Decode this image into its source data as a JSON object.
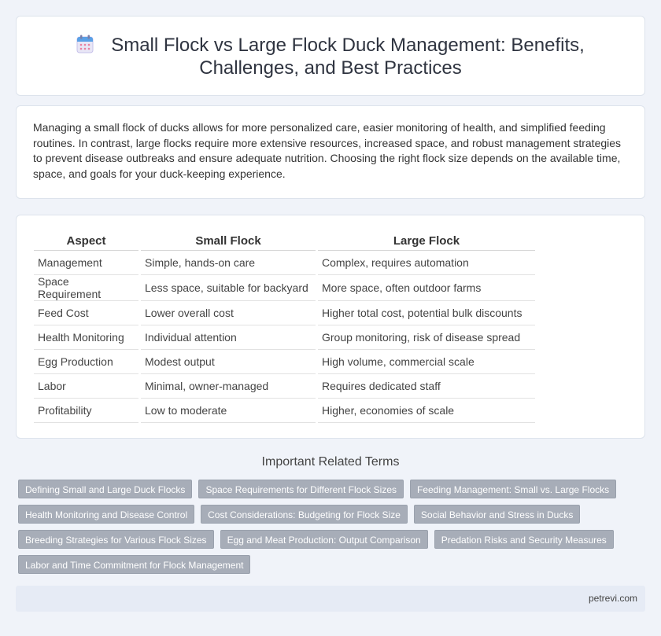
{
  "header": {
    "title_line1": "Small Flock vs Large Flock Duck Management: Benefits,",
    "title_line2": "Challenges, and Best Practices",
    "icon": "calendar-icon"
  },
  "intro": {
    "text": "Managing a small flock of ducks allows for more personalized care, easier monitoring of health, and simplified feeding routines. In contrast, large flocks require more extensive resources, increased space, and robust management strategies to prevent disease outbreaks and ensure adequate nutrition. Choosing the right flock size depends on the available time, space, and goals for your duck-keeping experience."
  },
  "comparison": {
    "headers": [
      "Aspect",
      "Small Flock",
      "Large Flock"
    ],
    "rows": [
      [
        "Management",
        "Simple, hands-on care",
        "Complex, requires automation"
      ],
      [
        "Space Requirement",
        "Less space, suitable for backyard",
        "More space, often outdoor farms"
      ],
      [
        "Feed Cost",
        "Lower overall cost",
        "Higher total cost, potential bulk discounts"
      ],
      [
        "Health Monitoring",
        "Individual attention",
        "Group monitoring, risk of disease spread"
      ],
      [
        "Egg Production",
        "Modest output",
        "High volume, commercial scale"
      ],
      [
        "Labor",
        "Minimal, owner-managed",
        "Requires dedicated staff"
      ],
      [
        "Profitability",
        "Low to moderate",
        "Higher, economies of scale"
      ]
    ]
  },
  "related": {
    "title": "Important Related Terms",
    "rows": [
      [
        "Defining Small and Large Duck Flocks",
        "Space Requirements for Different Flock Sizes",
        "Feeding Management: Small vs. Large Flocks"
      ],
      [
        "Health Monitoring and Disease Control",
        "Cost Considerations: Budgeting for Flock Size",
        "Social Behavior and Stress in Ducks"
      ],
      [
        "Breeding Strategies for Various Flock Sizes",
        "Egg and Meat Production: Output Comparison",
        "Predation Risks and Security Measures"
      ],
      [
        "Labor and Time Commitment for Flock Management"
      ]
    ]
  },
  "footer": {
    "site": "petrevi.com"
  },
  "colors": {
    "background": "#f0f3f9",
    "tag": "#a7adb8",
    "footer": "#e6ebf5"
  }
}
